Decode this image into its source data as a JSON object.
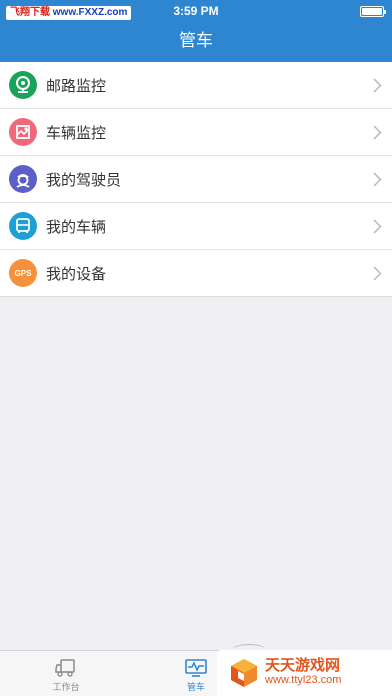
{
  "status_bar": {
    "time": "3:59 PM",
    "battery_level": 1.0
  },
  "watermark": {
    "name": "飞翔下载",
    "url": "www.FXXZ.com"
  },
  "header": {
    "title": "管车"
  },
  "menu": {
    "items": [
      {
        "label": "邮路监控",
        "icon": "webcam-icon",
        "color": "#1aa35a"
      },
      {
        "label": "车辆监控",
        "icon": "map-icon",
        "color": "#f0687a"
      },
      {
        "label": "我的驾驶员",
        "icon": "driver-icon",
        "color": "#5b5fc7"
      },
      {
        "label": "我的车辆",
        "icon": "bus-icon",
        "color": "#1e9fd6"
      },
      {
        "label": "我的设备",
        "icon": "gps-device-icon",
        "icon_text": "GPS",
        "color": "#f6913b"
      }
    ]
  },
  "tabbar": {
    "tabs": [
      {
        "label": "工作台",
        "icon": "truck-icon",
        "active": false
      },
      {
        "label": "管车",
        "icon": "monitor-icon",
        "active": true
      }
    ]
  },
  "site_badge": {
    "name": "天天游戏网",
    "url": "www.ttyl23.com"
  },
  "colors": {
    "accent": "#2f86d0",
    "background": "#efeff4"
  }
}
